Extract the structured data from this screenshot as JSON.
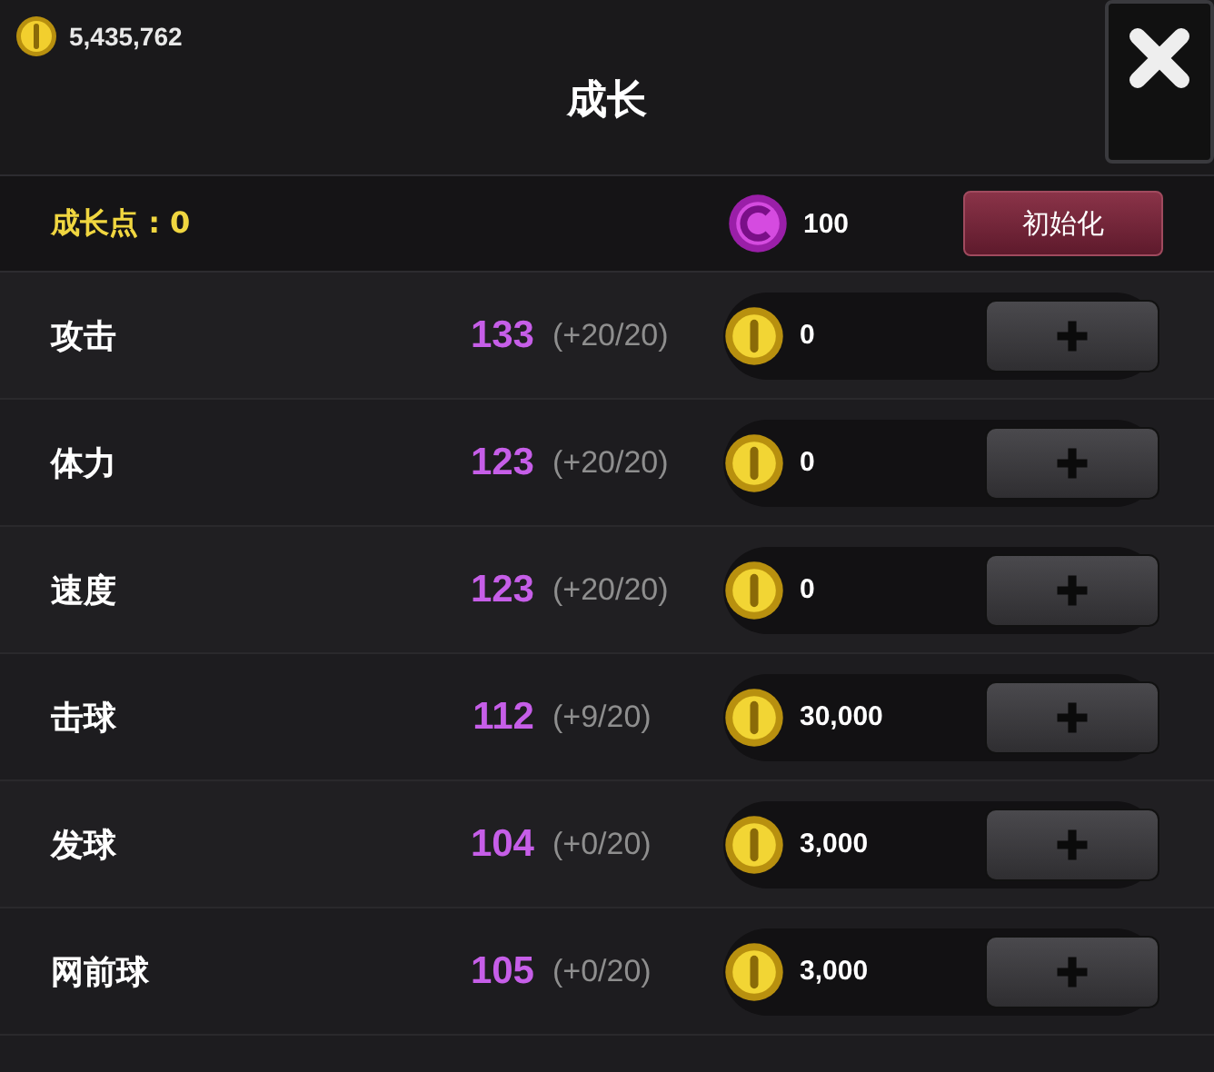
{
  "balance": "5,435,762",
  "title": "成长",
  "points": {
    "label": "成长点 : 0",
    "reset_cost": "100",
    "reset_button": "初始化"
  },
  "stats": [
    {
      "name": "攻击",
      "value": "133",
      "bonus": "(+20/20)",
      "cost": "0"
    },
    {
      "name": "体力",
      "value": "123",
      "bonus": "(+20/20)",
      "cost": "0"
    },
    {
      "name": "速度",
      "value": "123",
      "bonus": "(+20/20)",
      "cost": "0"
    },
    {
      "name": "击球",
      "value": "112",
      "bonus": "(+9/20)",
      "cost": "30,000"
    },
    {
      "name": "发球",
      "value": "104",
      "bonus": "(+0/20)",
      "cost": "3,000"
    },
    {
      "name": "网前球",
      "value": "105",
      "bonus": "(+0/20)",
      "cost": "3,000"
    }
  ]
}
